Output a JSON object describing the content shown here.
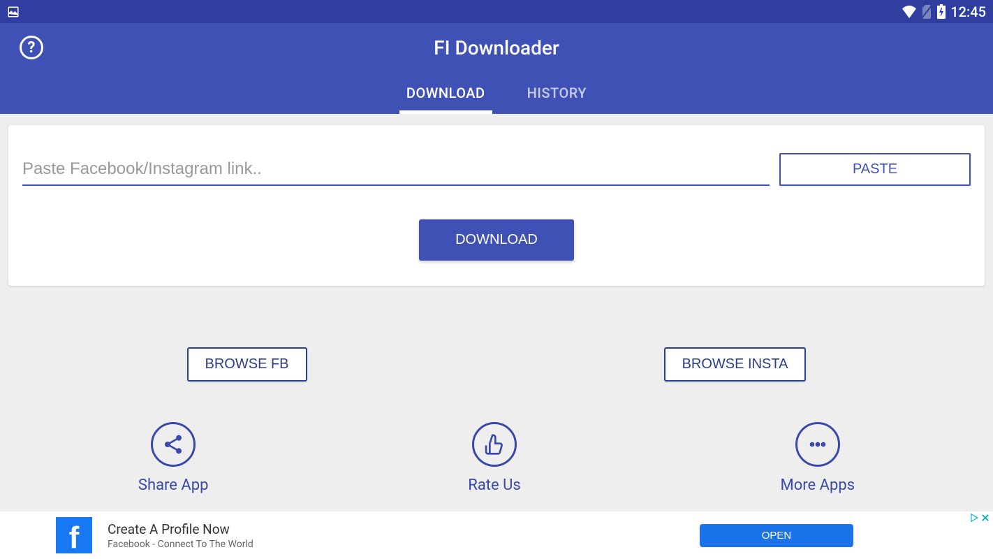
{
  "status_bar": {
    "time": "12:45"
  },
  "header": {
    "app_title": "FI Downloader"
  },
  "tabs": {
    "download": "DOWNLOAD",
    "history": "HISTORY"
  },
  "card": {
    "input_placeholder": "Paste Facebook/Instagram link..",
    "paste_button": "PASTE",
    "download_button": "DOWNLOAD"
  },
  "browse": {
    "fb": "BROWSE FB",
    "insta": "BROWSE INSTA"
  },
  "actions": {
    "share": "Share App",
    "rate": "Rate Us",
    "more": "More Apps"
  },
  "ad": {
    "logo_letter": "f",
    "title": "Create A Profile Now",
    "subtitle": "Facebook - Connect To The World",
    "open": "OPEN"
  }
}
